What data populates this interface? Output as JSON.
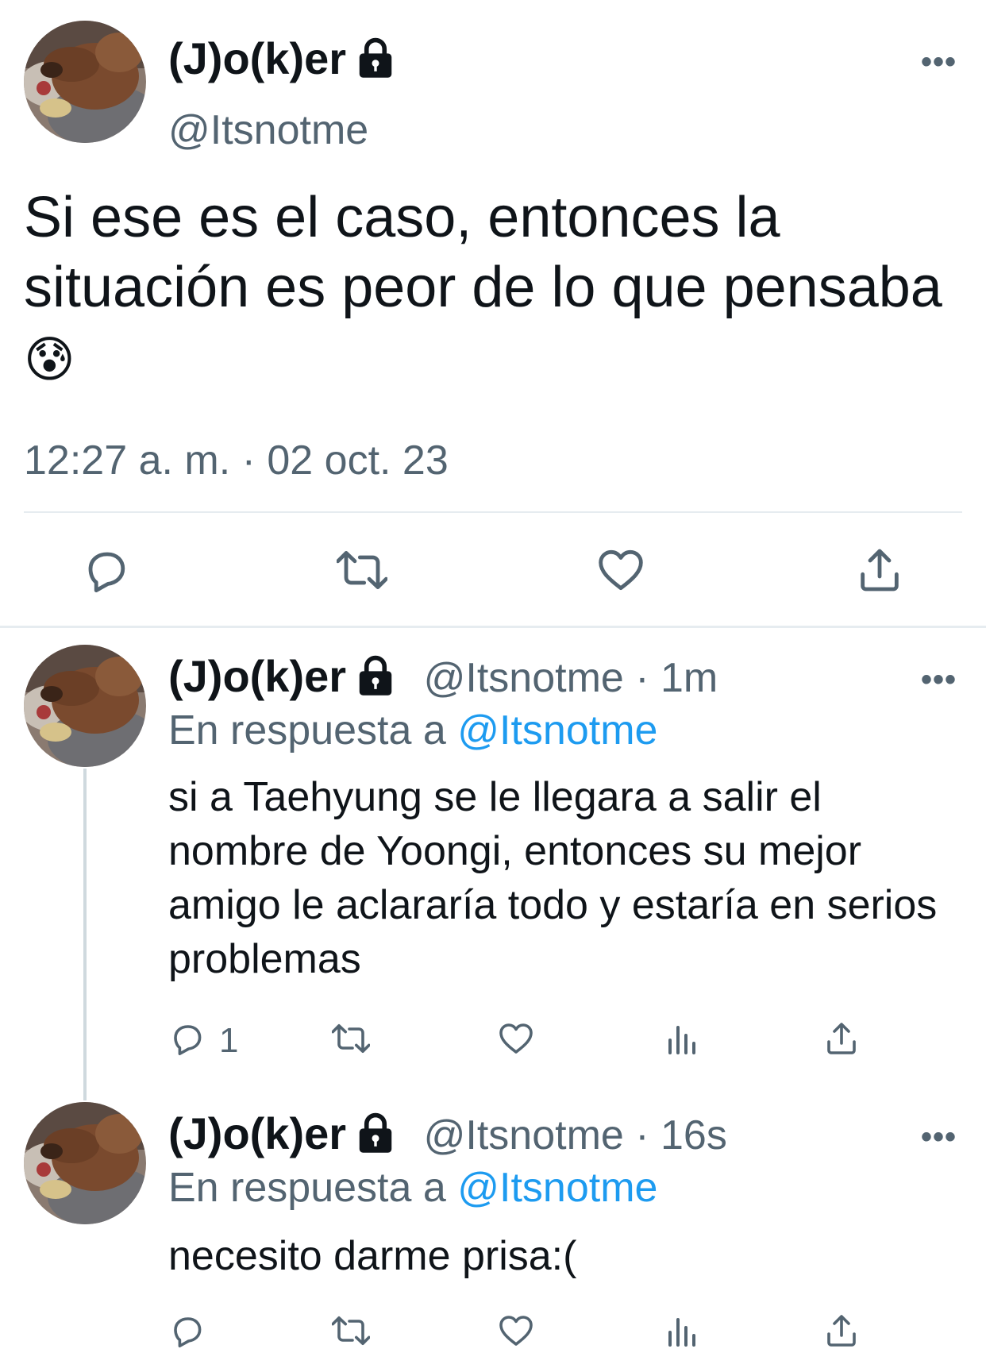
{
  "colors": {
    "accent": "#1d9bf0",
    "muted": "#536471",
    "text": "#0f1419",
    "divider": "#e6ecf0"
  },
  "main_tweet": {
    "display_name": "(J)o(k)er",
    "handle": "@Itsnotme",
    "lock_icon": "lock-icon",
    "text": "Si ese es el caso, entonces la situación es peor de lo que pensaba",
    "emoji": "😰",
    "timestamp": "12:27 a. m. · 02 oct. 23",
    "more": "•••",
    "actions": [
      "reply-icon",
      "retweet-icon",
      "like-icon",
      "share-icon"
    ]
  },
  "replies": [
    {
      "display_name": "(J)o(k)er",
      "handle_time": "@Itsnotme · 1m",
      "in_reply_prefix": "En respuesta a",
      "in_reply_handle": "@Itsnotme",
      "text": "si a Taehyung se le llegara a salir el nombre de Yoongi, entonces su mejor amigo le aclararía todo y estaría en serios problemas",
      "reply_count": "1",
      "more": "•••"
    },
    {
      "display_name": "(J)o(k)er",
      "handle_time": "@Itsnotme · 16s",
      "in_reply_prefix": "En respuesta a",
      "in_reply_handle": "@Itsnotme",
      "text": "necesito darme prisa:(",
      "reply_count": "",
      "more": "•••"
    }
  ]
}
